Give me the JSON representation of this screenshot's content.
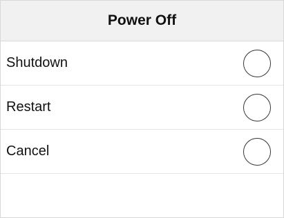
{
  "dialog": {
    "title": "Power Off",
    "options": [
      {
        "label": "Shutdown",
        "selected": false
      },
      {
        "label": "Restart",
        "selected": false
      },
      {
        "label": "Cancel",
        "selected": false
      }
    ]
  },
  "colors": {
    "header_bg": "#f1f1f1",
    "border": "#d9d9d9",
    "text": "#111111"
  }
}
